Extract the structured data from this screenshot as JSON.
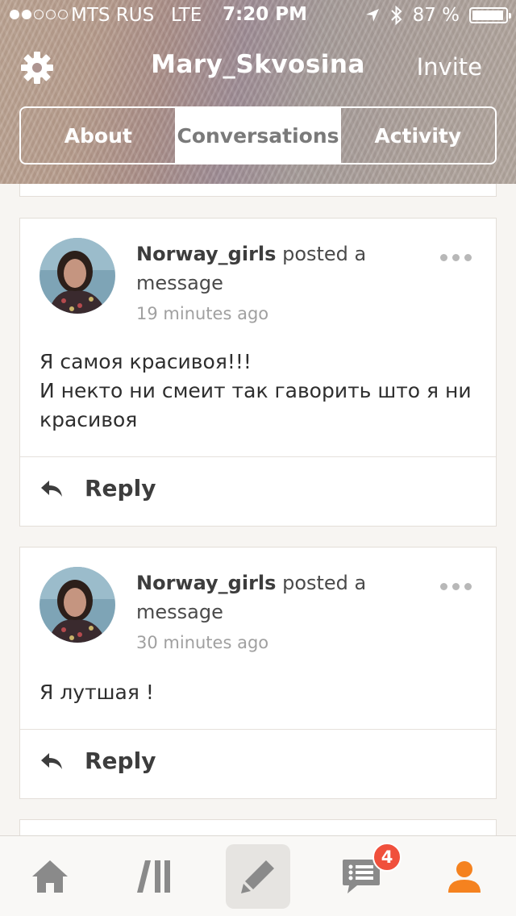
{
  "status_bar": {
    "carrier": "MTS RUS",
    "network": "LTE",
    "time": "7:20 PM",
    "battery_text": "87 %",
    "battery_level": 0.87
  },
  "header": {
    "settings_icon": "gear-icon",
    "title": "Mary_Skvosina",
    "invite_label": "Invite"
  },
  "tabs": [
    {
      "label": "About",
      "active": false
    },
    {
      "label": "Conversations",
      "active": true
    },
    {
      "label": "Activity",
      "active": false
    }
  ],
  "posts": [
    {
      "user": "Norway_girls",
      "action": "posted a message",
      "time": "19 minutes ago",
      "body": [
        "Я самоя красивоя!!!",
        "И некто ни смеит так гаворить што я ни красивоя"
      ],
      "reply_label": "Reply"
    },
    {
      "user": "Norway_girls",
      "action": "posted a message",
      "time": "30 minutes ago",
      "body": [
        "Я лутшая !"
      ],
      "reply_label": "Reply"
    }
  ],
  "tab_bar": {
    "items": [
      "home-icon",
      "library-icon",
      "compose-icon",
      "messages-icon",
      "profile-icon"
    ],
    "messages_badge": "4",
    "accent_color": "#f5821f",
    "icon_color": "#8a8a8a"
  }
}
